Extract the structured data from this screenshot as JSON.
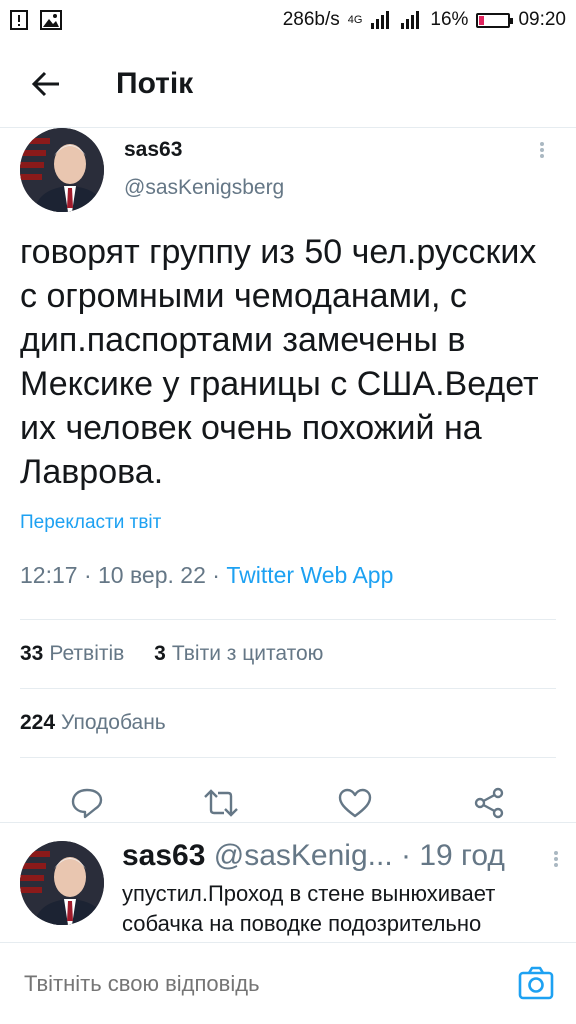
{
  "status_bar": {
    "net_speed": "286b/s",
    "network": "4G",
    "battery_percent": "16%",
    "battery_level": 0.16,
    "time": "09:20"
  },
  "header": {
    "title": "Потік"
  },
  "tweet": {
    "author_name": "sas63",
    "author_handle": "@sasKenigsberg",
    "text": "говорят группу из 50 чел.русских с огромными чемоданами, с дип.паспортами замечены в Мексике у границы с США.Ведет их человек очень похожий на Лаврова.",
    "translate_label": "Перекласти твіт",
    "timestamp": "12:17 · 10 вер. 22 · ",
    "source_app": "Twitter Web App",
    "retweets_count": "33",
    "retweets_label": "Ретвітів",
    "quotes_count": "3",
    "quotes_label": "Твіти з цитатою",
    "likes_count": "224",
    "likes_label": "Уподобань"
  },
  "reply": {
    "author_name": "sas63",
    "author_handle": "@sasKenig...",
    "separator": "·",
    "time": "19 год",
    "text": "упустил.Проход в стене вынюхивает собачка на поводке подозрительно"
  },
  "compose": {
    "placeholder": "Твітніть свою відповідь"
  },
  "colors": {
    "accent": "#1da1f2",
    "secondary_text": "#657786",
    "divider": "#e6ecf0"
  }
}
